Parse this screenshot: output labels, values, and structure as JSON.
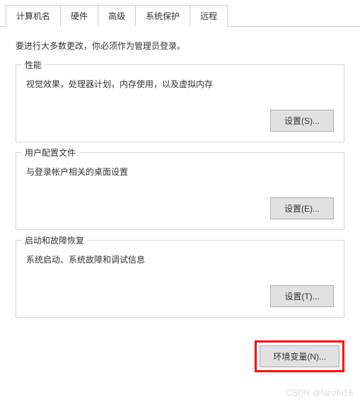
{
  "tabs": {
    "computer_name": "计算机名",
    "hardware": "硬件",
    "advanced": "高级",
    "system_protection": "系统保护",
    "remote": "远程"
  },
  "intro": "要进行大多数更改，你必须作为管理员登录。",
  "groups": {
    "performance": {
      "title": "性能",
      "desc": "视觉效果，处理器计划，内存使用，以及虚拟内存",
      "button": "设置(S)..."
    },
    "user_profile": {
      "title": "用户配置文件",
      "desc": "与登录帐户相关的桌面设置",
      "button": "设置(E)..."
    },
    "startup": {
      "title": "启动和故障恢复",
      "desc": "系统启动、系统故障和调试信息",
      "button": "设置(T)..."
    }
  },
  "env_button": "环境变量(N)...",
  "watermark": "CSDN @fanzhi16"
}
